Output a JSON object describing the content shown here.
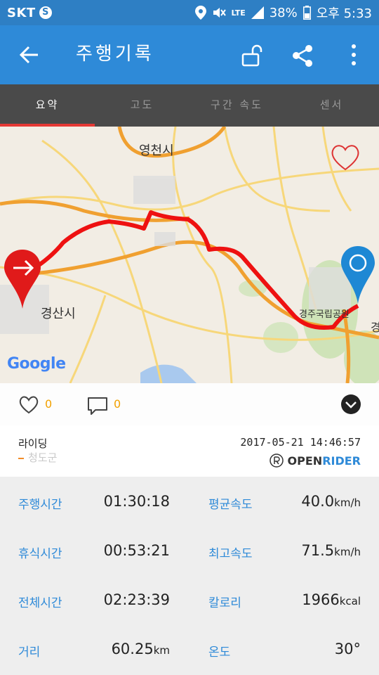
{
  "status_bar": {
    "carrier": "SKT",
    "carrier_badge": "S",
    "network": "LTE",
    "battery": "38%",
    "time": "오후 5:33"
  },
  "app_bar": {
    "title": "주행기록",
    "background": "#2e8ad8"
  },
  "tabs": [
    {
      "label": "요약",
      "active": true
    },
    {
      "label": "고도",
      "active": false
    },
    {
      "label": "구간 속도",
      "active": false
    },
    {
      "label": "센서",
      "active": false
    }
  ],
  "map": {
    "labels": {
      "yeongcheon": "영천시",
      "gyeongsan": "경산시",
      "gyeongju_park": "경주국립공원",
      "gyeong": "경"
    },
    "attribution": "Google"
  },
  "actions": {
    "like_count": "0",
    "comment_count": "0"
  },
  "info": {
    "activity_type": "라이딩",
    "region": "청도군",
    "datetime": "2017-05-21 14:46:57",
    "brand_open": "OPEN",
    "brand_rider": "RIDER"
  },
  "stats": {
    "ride_time_label": "주행시간",
    "ride_time": "01:30:18",
    "avg_speed_label": "평균속도",
    "avg_speed": "40.0",
    "avg_speed_unit": "km/h",
    "rest_time_label": "휴식시간",
    "rest_time": "00:53:21",
    "max_speed_label": "최고속도",
    "max_speed": "71.5",
    "max_speed_unit": "km/h",
    "total_time_label": "전체시간",
    "total_time": "02:23:39",
    "calorie_label": "칼로리",
    "calorie": "1966",
    "calorie_unit": "kcal",
    "distance_label": "거리",
    "distance": "60.25",
    "distance_unit": "km",
    "temp_label": "온도",
    "temp": "30°"
  }
}
